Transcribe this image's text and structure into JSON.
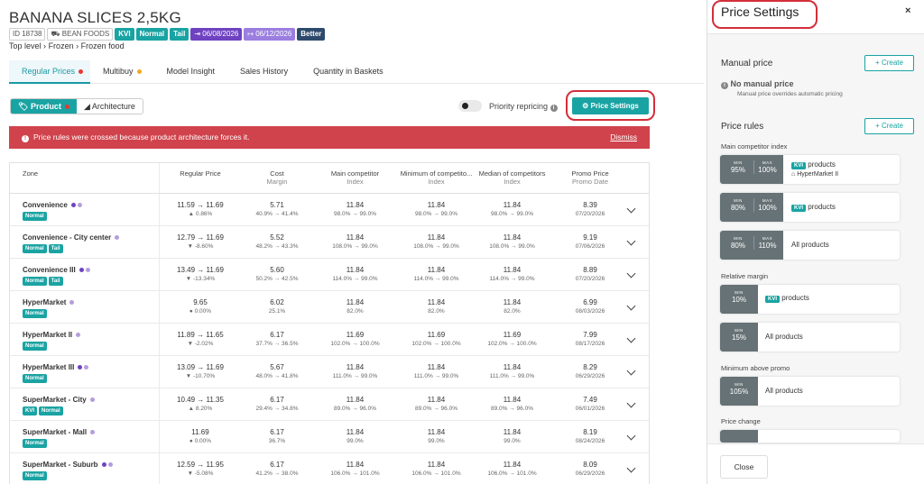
{
  "product": {
    "title": "BANANA SLICES 2,5KG",
    "id": "ID 18738",
    "brand": "BEAN FOODS",
    "tag_kvi": "KVI",
    "tag_normal": "Normal",
    "tag_tail": "Tail",
    "date1": "06/08/2026",
    "date2": "06/12/2026",
    "better": "Better"
  },
  "breadcrumb": {
    "l1": "Top level",
    "l2": "Frozen",
    "l3": "Frozen food",
    "sep": "›"
  },
  "tabs": [
    {
      "label": "Regular Prices"
    },
    {
      "label": "Multibuy"
    },
    {
      "label": "Model Insight"
    },
    {
      "label": "Sales History"
    },
    {
      "label": "Quantity in Baskets"
    }
  ],
  "toolbar": {
    "product": "Product",
    "architecture": "Architecture",
    "priority": "Priority repricing",
    "price_settings": "Price Settings"
  },
  "alert": {
    "text": "Price rules were crossed because product architecture forces it.",
    "dismiss": "Dismiss"
  },
  "columns": {
    "zone": "Zone",
    "regular": "Regular Price",
    "cost": "Cost",
    "cost_sub": "Margin",
    "main": "Main competitor",
    "main_sub": "Index",
    "min": "Minimum of competito...",
    "min_sub": "Index",
    "median": "Median of competitors",
    "median_sub": "Index",
    "promo": "Promo Price",
    "promo_sub": "Promo Date"
  },
  "rows": [
    {
      "zone": "Convenience",
      "tags": [
        "Normal"
      ],
      "price": "11.59 → 11.69",
      "chg": "▲ 0.86%",
      "dir": "up",
      "cost": "5.71",
      "margin": "40.9% → 41.4%",
      "main": "11.84",
      "main_i": "98.0% → 99.0%",
      "min": "11.84",
      "min_i": "98.0% → 99.0%",
      "med": "11.84",
      "med_i": "98.0% → 99.0%",
      "promo": "8.39",
      "pdate": "07/20/2026"
    },
    {
      "zone": "Convenience - City center",
      "tags": [
        "Normal",
        "Tail"
      ],
      "price": "12.79 → 11.69",
      "chg": "▼ -8.60%",
      "dir": "dn",
      "cost": "5.52",
      "margin": "48.2% → 43.3%",
      "main": "11.84",
      "main_i": "108.0% → 99.0%",
      "min": "11.84",
      "min_i": "108.0% → 99.0%",
      "med": "11.84",
      "med_i": "108.0% → 99.0%",
      "promo": "9.19",
      "pdate": "07/06/2026"
    },
    {
      "zone": "Convenience III",
      "tags": [
        "Normal",
        "Tail"
      ],
      "price": "13.49 → 11.69",
      "chg": "▼ -13.34%",
      "dir": "dn",
      "cost": "5.60",
      "margin": "50.2% → 42.5%",
      "main": "11.84",
      "main_i": "114.0% → 99.0%",
      "min": "11.84",
      "min_i": "114.0% → 99.0%",
      "med": "11.84",
      "med_i": "114.0% → 99.0%",
      "promo": "8.89",
      "pdate": "07/20/2026"
    },
    {
      "zone": "HyperMarket",
      "tags": [
        "Normal"
      ],
      "price": "9.65",
      "chg": "● 0.00%",
      "dir": "nz",
      "cost": "6.02",
      "margin": "25.1%",
      "main": "11.84",
      "main_i": "82.0%",
      "min": "11.84",
      "min_i": "82.0%",
      "med": "11.84",
      "med_i": "82.0%",
      "promo": "6.99",
      "pdate": "08/03/2026"
    },
    {
      "zone": "HyperMarket II",
      "tags": [
        "Normal"
      ],
      "price": "11.89 → 11.65",
      "chg": "▼ -2.02%",
      "dir": "dn",
      "cost": "6.17",
      "margin": "37.7% → 36.5%",
      "main": "11.69",
      "main_i": "102.0% → 100.0%",
      "min": "11.69",
      "min_i": "102.0% → 100.0%",
      "med": "11.69",
      "med_i": "102.0% → 100.0%",
      "promo": "7.99",
      "pdate": "08/17/2026"
    },
    {
      "zone": "HyperMarket III",
      "tags": [
        "Normal"
      ],
      "price": "13.09 → 11.69",
      "chg": "▼ -10.70%",
      "dir": "dn",
      "cost": "5.67",
      "margin": "48.0% → 41.8%",
      "main": "11.84",
      "main_i": "111.0% → 99.0%",
      "min": "11.84",
      "min_i": "111.0% → 99.0%",
      "med": "11.84",
      "med_i": "111.0% → 99.0%",
      "promo": "8.29",
      "pdate": "06/29/2026"
    },
    {
      "zone": "SuperMarket - City",
      "tags": [
        "KVI",
        "Normal"
      ],
      "price": "10.49 → 11.35",
      "chg": "▲ 8.20%",
      "dir": "up",
      "cost": "6.17",
      "margin": "29.4% → 34.8%",
      "main": "11.84",
      "main_i": "89.0% → 96.0%",
      "min": "11.84",
      "min_i": "89.0% → 96.0%",
      "med": "11.84",
      "med_i": "89.0% → 96.0%",
      "promo": "7.49",
      "pdate": "06/01/2026"
    },
    {
      "zone": "SuperMarket - Mall",
      "tags": [
        "Normal"
      ],
      "price": "11.69",
      "chg": "● 0.00%",
      "dir": "nz",
      "cost": "6.17",
      "margin": "36.7%",
      "main": "11.84",
      "main_i": "99.0%",
      "min": "11.84",
      "min_i": "99.0%",
      "med": "11.84",
      "med_i": "99.0%",
      "promo": "8.19",
      "pdate": "08/24/2026"
    },
    {
      "zone": "SuperMarket - Suburb",
      "tags": [
        "Normal"
      ],
      "price": "12.59 → 11.95",
      "chg": "▼ -5.08%",
      "dir": "dn",
      "cost": "6.17",
      "margin": "41.2% → 38.0%",
      "main": "11.84",
      "main_i": "106.0% → 101.0%",
      "min": "11.84",
      "min_i": "106.0% → 101.0%",
      "med": "11.84",
      "med_i": "106.0% → 101.0%",
      "promo": "8.09",
      "pdate": "06/29/2026"
    }
  ],
  "panel": {
    "title": "Price Settings",
    "close_x": "×",
    "manual": "Manual price",
    "create": "+ Create",
    "no_manual": "No manual price",
    "no_manual_sub": "Manual price overrides automatic pricing",
    "rules": "Price rules",
    "main_idx": "Main competitor index",
    "min_lbl": "MIN",
    "max_lbl": "MAX",
    "c1_min": "95%",
    "c1_max": "100%",
    "c1_kvi": "KVI",
    "c1_txt": "products",
    "c1_store": "HyperMarket II",
    "c2_min": "80%",
    "c2_max": "100%",
    "c2_kvi": "KVI",
    "c2_txt": "products",
    "c3_min": "80%",
    "c3_max": "110%",
    "c3_txt": "All products",
    "rel_margin": "Relative margin",
    "c4_min": "10%",
    "c4_kvi": "KVI",
    "c4_txt": "products",
    "c5_min": "15%",
    "c5_txt": "All products",
    "min_promo": "Minimum above promo",
    "c6_min": "105%",
    "c6_txt": "All products",
    "price_change": "Price change",
    "close": "Close"
  },
  "colors": {
    "accent": "#1aa3a3",
    "alert": "#d0434c",
    "dot_red": "#e53935",
    "dot_orange": "#f5a623",
    "dot_purple": "#8e6bd8"
  }
}
